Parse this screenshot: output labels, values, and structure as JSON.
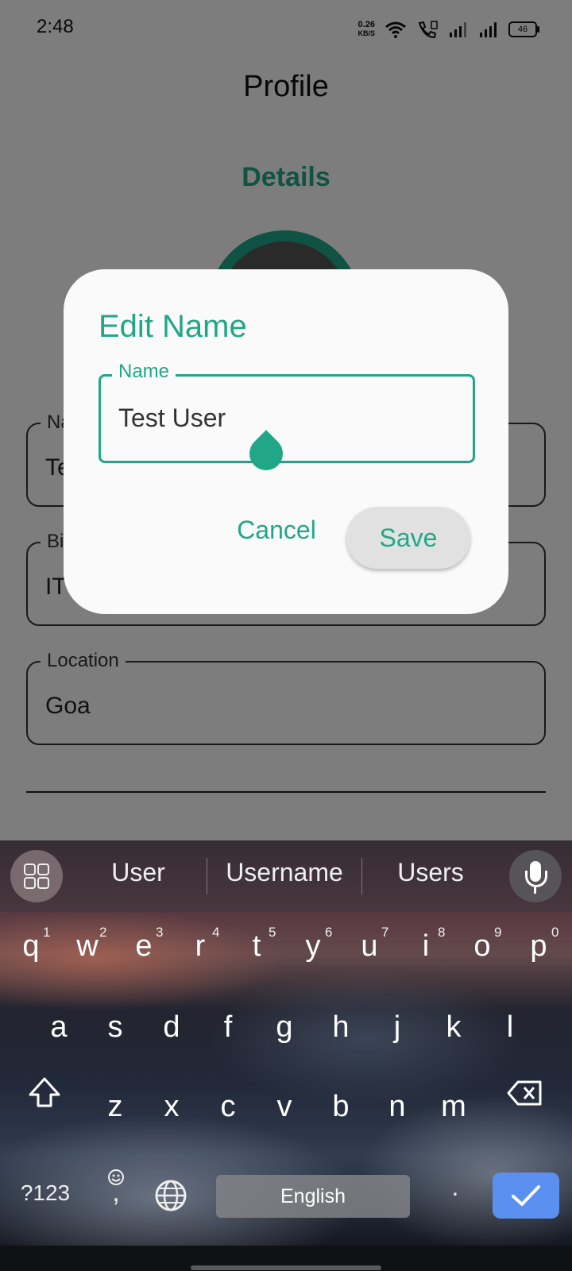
{
  "status_bar": {
    "time": "2:48",
    "net_speed_value": "0.26",
    "net_speed_unit": "KB/S",
    "battery": "46"
  },
  "appbar": {
    "title": "Profile"
  },
  "details": {
    "section_title": "Details"
  },
  "profile_fields": [
    {
      "label": "Na",
      "value": "Te"
    },
    {
      "label": "Bi",
      "value": "IT"
    },
    {
      "label": "Location",
      "value": "Goa"
    }
  ],
  "dialog": {
    "title": "Edit Name",
    "field_label": "Name",
    "field_value": "Test User",
    "cancel_label": "Cancel",
    "save_label": "Save"
  },
  "keyboard": {
    "suggestions": [
      "User",
      "Username",
      "Users"
    ],
    "row1": [
      "q",
      "w",
      "e",
      "r",
      "t",
      "y",
      "u",
      "i",
      "o",
      "p"
    ],
    "row1_hints": [
      "1",
      "2",
      "3",
      "4",
      "5",
      "6",
      "7",
      "8",
      "9",
      "0"
    ],
    "row2": [
      "a",
      "s",
      "d",
      "f",
      "g",
      "h",
      "j",
      "k",
      "l"
    ],
    "row3": [
      "z",
      "x",
      "c",
      "v",
      "b",
      "n",
      "m"
    ],
    "symbols_label": "?123",
    "comma_label": ",",
    "space_label": "English",
    "period_label": "."
  },
  "colors": {
    "accent": "#21a788",
    "enter_key": "#5b8ff0"
  },
  "icons": [
    "wifi-icon",
    "call-icon",
    "signal-icon",
    "battery-icon",
    "apps-grid-icon",
    "mic-icon",
    "shift-icon",
    "backspace-icon",
    "emoji-icon",
    "globe-icon",
    "check-icon"
  ]
}
